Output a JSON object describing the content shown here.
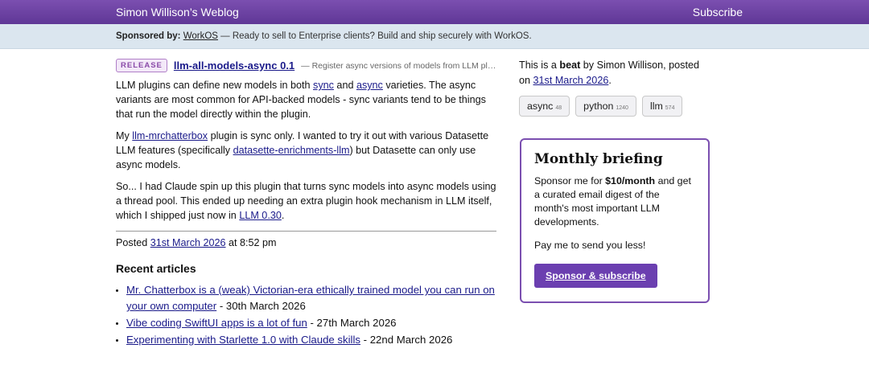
{
  "header": {
    "site_title": "Simon Willison’s Weblog",
    "subscribe": "Subscribe"
  },
  "sponsor": {
    "label": "Sponsored by:",
    "sponsor_name": "WorkOS",
    "message": " — Ready to sell to Enterprise clients? Build and ship securely with WorkOS."
  },
  "release": {
    "badge": "RELEASE",
    "title": "llm-all-models-async 0.1",
    "description": "— Register async versions of models from LLM plugi..."
  },
  "body": {
    "p1_a": "LLM plugins can define new models in both ",
    "p1_link1": "sync",
    "p1_b": " and ",
    "p1_link2": "async",
    "p1_c": " varieties. The async variants are most common for API-backed models - sync variants tend to be things that run the model directly within the plugin.",
    "p2_a": "My ",
    "p2_link1": "llm-mrchatterbox",
    "p2_b": " plugin is sync only. I wanted to try it out with various Datasette LLM features (specifically ",
    "p2_link2": "datasette-enrichments-llm",
    "p2_c": ") but Datasette can only use async models.",
    "p3_a": "So... I had Claude spin up this plugin that turns sync models into async models using a thread pool. This ended up needing an extra plugin hook mechanism in LLM itself, which I shipped just now in ",
    "p3_link": "LLM 0.30",
    "p3_b": "."
  },
  "posted": {
    "prefix": "Posted ",
    "date": "31st March 2026",
    "time": " at 8:52 pm"
  },
  "recent": {
    "heading": "Recent articles",
    "items": [
      {
        "title": "Mr. Chatterbox is a (weak) Victorian-era ethically trained model you can run on your own computer",
        "date": " - 30th March 2026"
      },
      {
        "title": "Vibe coding SwiftUI apps is a lot of fun",
        "date": " - 27th March 2026"
      },
      {
        "title": "Experimenting with Starlette 1.0 with Claude skills",
        "date": " - 22nd March 2026"
      }
    ]
  },
  "sidebar": {
    "meta_a": "This is a ",
    "meta_bold": "beat",
    "meta_b": " by Simon Willison, posted on ",
    "meta_date": "31st March 2026",
    "meta_c": ".",
    "tags": [
      {
        "name": "async",
        "count": "48"
      },
      {
        "name": "python",
        "count": "1240"
      },
      {
        "name": "llm",
        "count": "574"
      }
    ]
  },
  "briefing": {
    "title": "Monthly briefing",
    "text_a": "Sponsor me for ",
    "text_bold": "$10/month",
    "text_b": " and get a curated email digest of the month's most important LLM developments.",
    "text2": "Pay me to send you less!",
    "button": "Sponsor & subscribe"
  },
  "colors": {
    "accent": "#6b3fb0",
    "header": "#5f3796",
    "sponsor_bg": "#dbe6ef",
    "link": "#1a1a8a"
  }
}
